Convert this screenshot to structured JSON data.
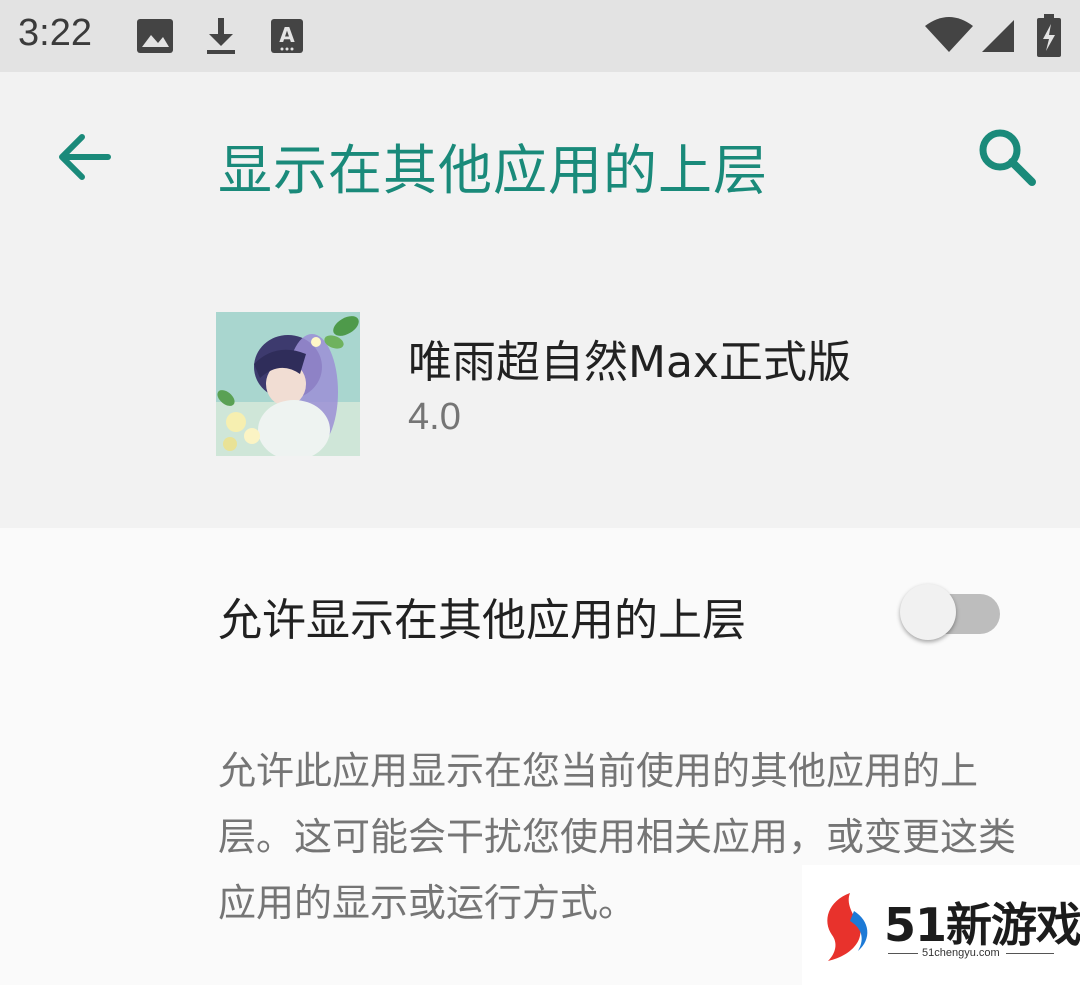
{
  "status_bar": {
    "time": "3:22",
    "left_icons": [
      "image-icon",
      "download-icon",
      "font-a-icon"
    ],
    "right_icons": [
      "wifi-icon",
      "signal-icon",
      "battery-charging-icon"
    ]
  },
  "app_bar": {
    "title": "显示在其他应用的上层",
    "back_icon": "arrow-back-icon",
    "search_icon": "search-icon"
  },
  "app_info": {
    "name": "唯雨超自然Max正式版",
    "version": "4.0"
  },
  "permission": {
    "label": "允许显示在其他应用的上层",
    "enabled": false,
    "description": "允许此应用显示在您当前使用的其他应用的上层。这可能会干扰您使用相关应用，或变更这类应用的显示或运行方式。"
  },
  "watermark": {
    "brand": "51新游戏",
    "url": "51chengyu.com"
  },
  "colors": {
    "accent": "#1a8a7a",
    "status_bar_bg": "#e3e3e3",
    "background": "#f2f2f2",
    "content_bg": "#fafafa"
  }
}
